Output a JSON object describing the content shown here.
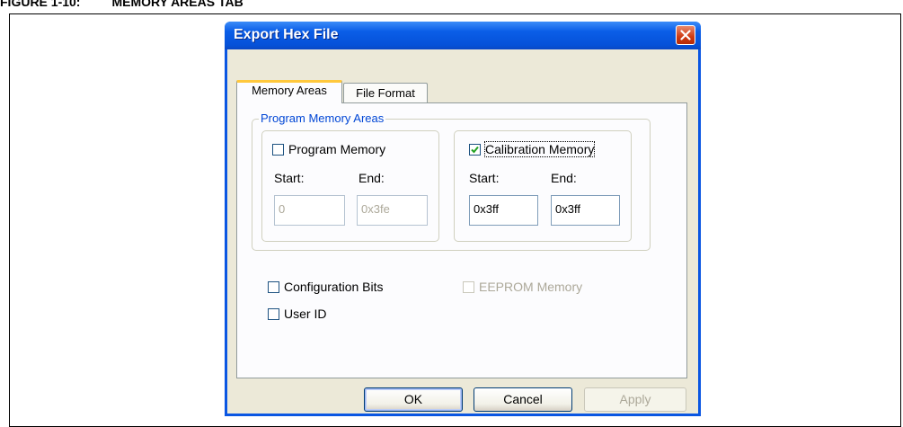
{
  "figure": {
    "caption": "FIGURE 1-10:         MEMORY AREAS TAB"
  },
  "dialog": {
    "title": "Export Hex File",
    "tabs": [
      {
        "label": "Memory Areas",
        "active": true
      },
      {
        "label": "File Format",
        "active": false
      }
    ],
    "program_memory_areas": {
      "legend": "Program Memory Areas",
      "program_memory": {
        "label": "Program Memory",
        "checked": false,
        "start_label": "Start:",
        "end_label": "End:",
        "start_value": "0",
        "end_value": "0x3fe"
      },
      "calibration_memory": {
        "label": "Calibration Memory",
        "checked": true,
        "start_label": "Start:",
        "end_label": "End:",
        "start_value": "0x3ff",
        "end_value": "0x3ff"
      }
    },
    "options": {
      "configuration_bits": {
        "label": "Configuration Bits",
        "checked": false
      },
      "eeprom_memory": {
        "label": "EEPROM Memory",
        "checked": false,
        "enabled": false
      },
      "user_id": {
        "label": "User ID",
        "checked": false
      }
    },
    "buttons": {
      "ok": "OK",
      "cancel": "Cancel",
      "apply": "Apply"
    }
  },
  "colors": {
    "titlebar": "#0b5ee8",
    "legend": "#0046d5",
    "tab_highlight": "#ffc83c",
    "close_button": "#cf3a12",
    "check_mark": "#21a121"
  }
}
